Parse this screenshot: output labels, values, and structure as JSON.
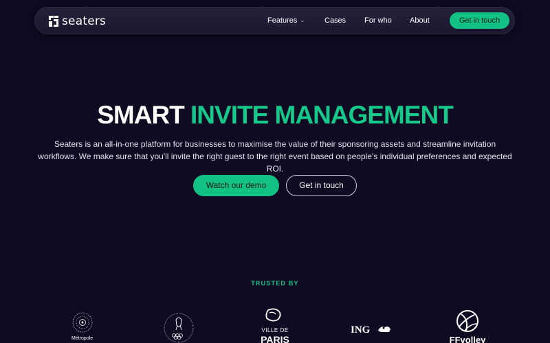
{
  "nav": {
    "brand": "seaters",
    "items": [
      {
        "label": "Features",
        "has_dropdown": true
      },
      {
        "label": "Cases"
      },
      {
        "label": "For who"
      },
      {
        "label": "About"
      }
    ],
    "cta_label": "Get in touch"
  },
  "hero": {
    "title_part1": "SMART",
    "title_part2": "INVITE MANAGEMENT",
    "subtitle": "Seaters is an all-in-one platform for businesses to maximise the value of their sponsoring assets and streamline invitation workflows. We make sure that you'll invite the right guest to the right event based on people's individual preferences and expected ROI.",
    "primary_button": "Watch our demo",
    "secondary_button": "Get in touch"
  },
  "trusted": {
    "label": "TRUSTED BY",
    "logos": [
      {
        "name": "metropole-logo",
        "caption": "Métropole"
      },
      {
        "name": "comite-national-logo",
        "caption": ""
      },
      {
        "name": "ville-de-paris-logo",
        "line1": "VILLE DE",
        "line2": "PARIS"
      },
      {
        "name": "ing-logo",
        "text": "ING"
      },
      {
        "name": "ffvolley-logo",
        "text": "FFvolley"
      }
    ]
  },
  "colors": {
    "background": "#0e0b22",
    "accent": "#14c98a",
    "button": "#12c284"
  }
}
